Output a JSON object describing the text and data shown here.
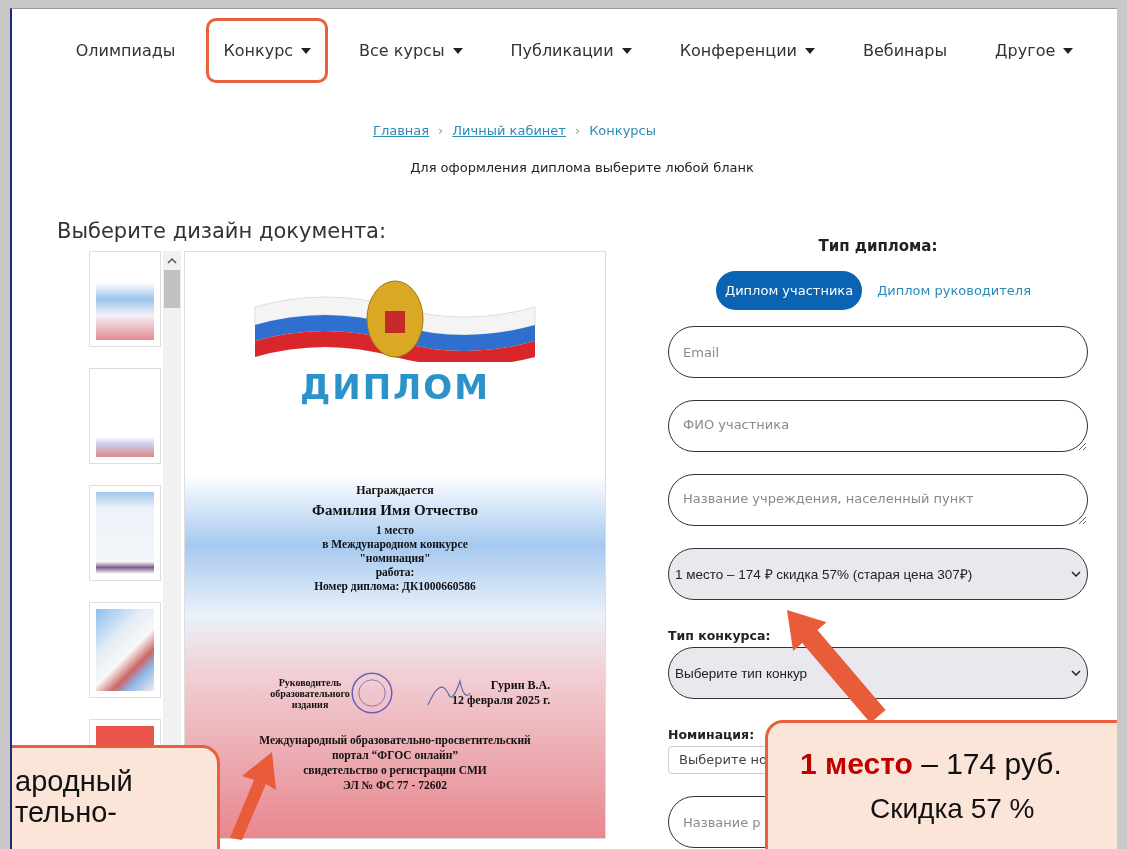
{
  "nav": [
    {
      "label": "Олимпиады",
      "has_menu": false,
      "highlighted": false
    },
    {
      "label": "Конкурс",
      "has_menu": true,
      "highlighted": true
    },
    {
      "label": "Все курсы",
      "has_menu": true,
      "highlighted": false
    },
    {
      "label": "Публикации",
      "has_menu": true,
      "highlighted": false
    },
    {
      "label": "Конференции",
      "has_menu": true,
      "highlighted": false
    },
    {
      "label": "Вебинары",
      "has_menu": false,
      "highlighted": false
    },
    {
      "label": "Другое",
      "has_menu": true,
      "highlighted": false
    }
  ],
  "breadcrumbs": [
    {
      "label": "Главная",
      "link": true
    },
    {
      "separator": "›",
      "label": "Личный кабинет",
      "link": true
    },
    {
      "separator": "›",
      "label": "Конкурсы",
      "link": false
    }
  ],
  "subtitle": "Для оформления диплома выберите любой бланк",
  "design": {
    "heading": "Выберите дизайн документа:",
    "thumbnails": [
      {
        "kind": "gradient"
      },
      {
        "kind": "flag-top"
      },
      {
        "kind": "flag-band"
      },
      {
        "kind": "diagonal"
      },
      {
        "kind": "red-pattern"
      }
    ],
    "preview": {
      "title": "ДИПЛОМ",
      "awarded": "Награждается",
      "name": "Фамилия Имя Отчество",
      "lines": [
        "1 место",
        "в Международном конкурсе",
        "\"номинация\"",
        "работа:",
        "Номер диплома: ДК1000660586"
      ],
      "signer_left": [
        "Руководитель",
        "образовательного издания"
      ],
      "signer_right": [
        "Гурин В.А.",
        "12 февраля 2025 г."
      ],
      "footer": [
        "Международный образовательно-просветительский",
        "портал “ФГОС онлайн”",
        "свидетельство о регистрации СМИ",
        "ЭЛ № ФС 77 - 72602"
      ]
    }
  },
  "form": {
    "heading": "Тип диплома:",
    "tabs": [
      {
        "label": "Диплом участника",
        "selected": true
      },
      {
        "label": "Диплом руководителя",
        "selected": false
      }
    ],
    "fields": [
      {
        "kind": "input",
        "placeholder": "Email"
      },
      {
        "kind": "textarea",
        "placeholder": "ФИО участника"
      },
      {
        "kind": "textarea",
        "placeholder": "Название учреждения, населенный пункт"
      },
      {
        "kind": "select",
        "value": "1 место – 174 ₽ скидка 57% (старая цена 307₽)"
      },
      {
        "kind": "select",
        "label": "Тип конкурса:",
        "value": "Выберите тип конкур"
      },
      {
        "kind": "small-select",
        "label": "Номинация:",
        "value": "Выберите но"
      },
      {
        "kind": "input",
        "placeholder": "Название р"
      }
    ]
  },
  "callouts": [
    {
      "lines": [
        "ародный",
        "тельно-"
      ]
    },
    {
      "lines": [
        "**1 место** – 174 руб.",
        "Скидка 57 %"
      ]
    }
  ]
}
